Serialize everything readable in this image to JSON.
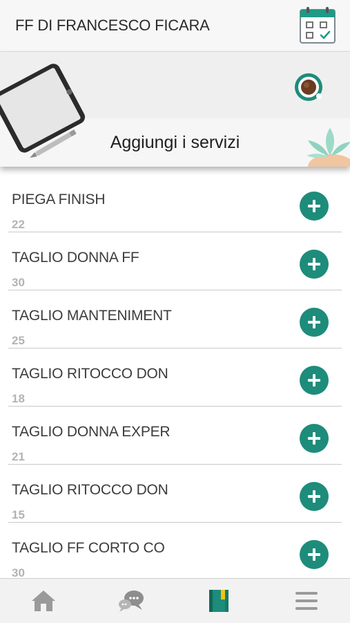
{
  "header": {
    "title": "FF DI FRANCESCO FICARA",
    "icon": "calendar-check-icon"
  },
  "banner": {
    "title": "Aggiungi i servizi"
  },
  "services": [
    {
      "name": "PIEGA FINISH",
      "number": "22"
    },
    {
      "name": "TAGLIO DONNA FF",
      "number": "30"
    },
    {
      "name": "TAGLIO MANTENIMENT",
      "number": "25"
    },
    {
      "name": "TAGLIO RITOCCO DON",
      "number": "18"
    },
    {
      "name": "TAGLIO DONNA EXPER",
      "number": "21"
    },
    {
      "name": "TAGLIO RITOCCO DON",
      "number": "15"
    },
    {
      "name": "TAGLIO FF CORTO CO",
      "number": "30"
    }
  ],
  "tabbar": {
    "items": [
      "home-icon",
      "chat-icon",
      "notebook-icon",
      "menu-icon"
    ],
    "active": "notebook-icon"
  },
  "colors": {
    "accent": "#1e8c7a",
    "header_bg": "#f7f7f7",
    "secondary_text": "#b3b3b3"
  }
}
